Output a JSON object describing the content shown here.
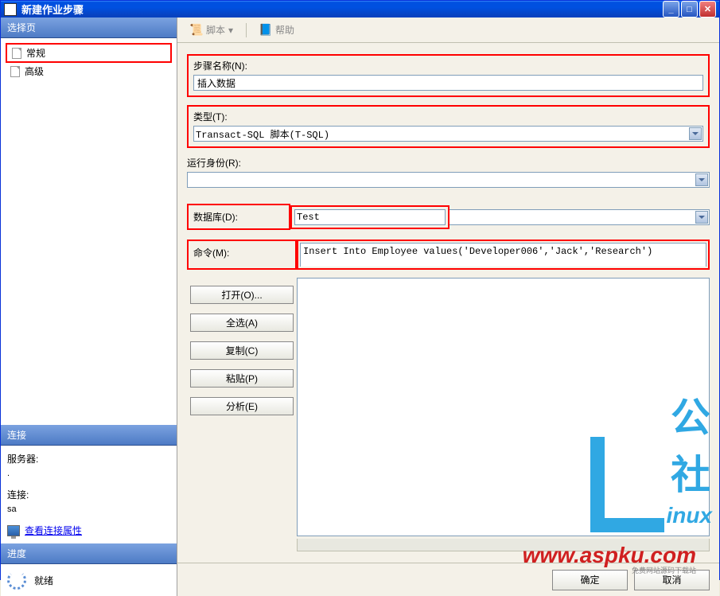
{
  "window": {
    "title": "新建作业步骤"
  },
  "sidebar": {
    "select_page_header": "选择页",
    "items": [
      {
        "label": "常规"
      },
      {
        "label": "高级"
      }
    ],
    "connection_header": "连接",
    "server_label": "服务器:",
    "server_value": ".",
    "conn_label": "连接:",
    "conn_value": "sa",
    "view_props": "查看连接属性",
    "progress_header": "进度",
    "progress_status": "就绪"
  },
  "toolbar": {
    "script": "脚本",
    "help": "帮助"
  },
  "form": {
    "step_name_label": "步骤名称(N):",
    "step_name_value": "插入数据",
    "type_label": "类型(T):",
    "type_value": "Transact-SQL 脚本(T-SQL)",
    "run_as_label": "运行身份(R):",
    "run_as_value": "",
    "database_label": "数据库(D):",
    "database_value": "Test",
    "command_label": "命令(M):",
    "command_value": "Insert Into Employee values('Developer006','Jack','Research')",
    "open_btn": "打开(O)...",
    "select_all_btn": "全选(A)",
    "copy_btn": "复制(C)",
    "paste_btn": "粘贴(P)",
    "parse_btn": "分析(E)"
  },
  "footer": {
    "ok": "确定",
    "cancel": "取消"
  },
  "watermark": {
    "brand1": "公社",
    "brand2": "inux",
    "brand3": "www.aspku.com",
    "brand4": "免费网站源码下载站"
  }
}
